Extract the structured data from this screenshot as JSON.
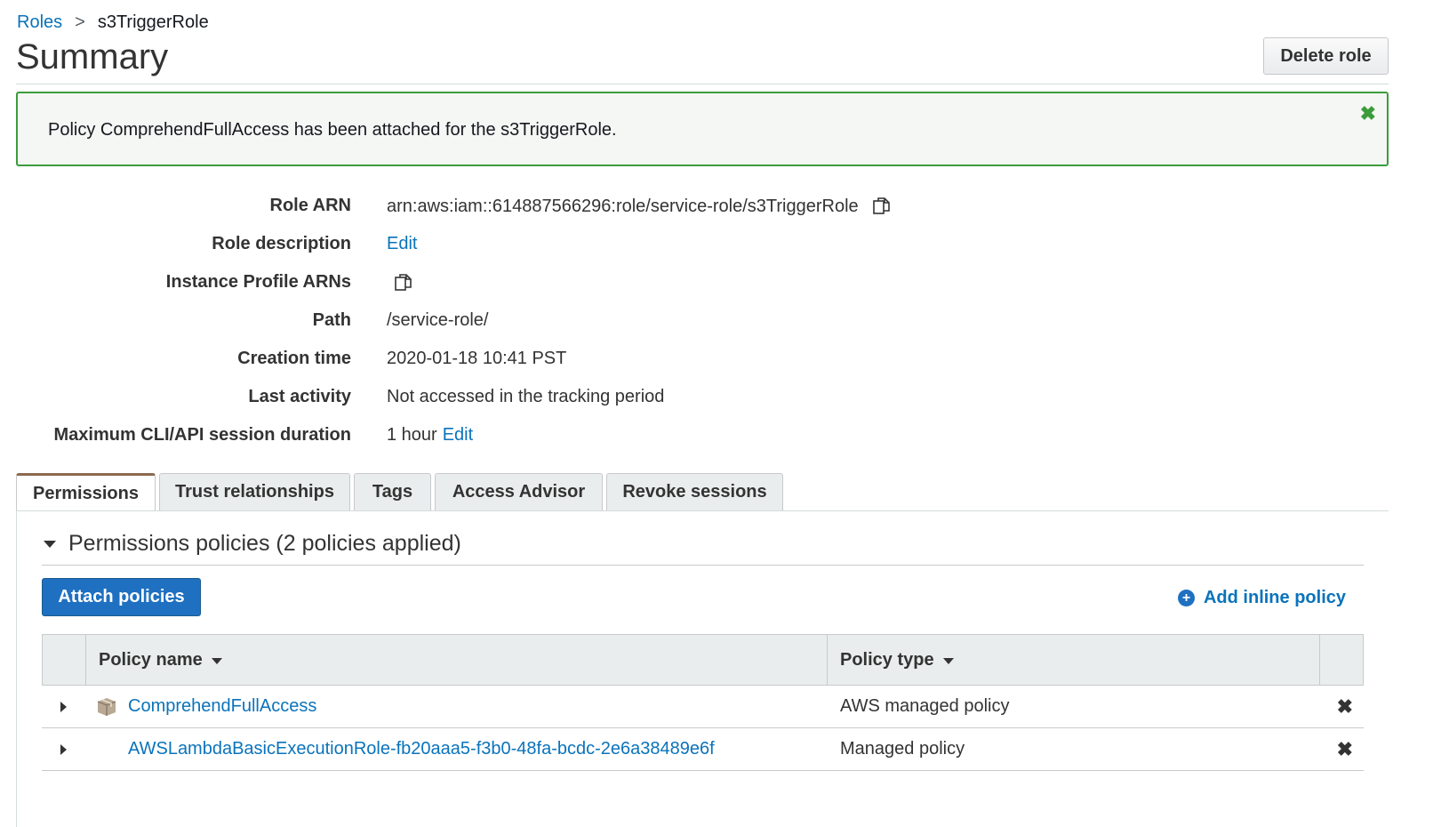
{
  "breadcrumb": {
    "parent": "Roles",
    "separator": ">",
    "current": "s3TriggerRole"
  },
  "page": {
    "title": "Summary",
    "delete_label": "Delete role"
  },
  "alert": {
    "message": "Policy ComprehendFullAccess has been attached for the s3TriggerRole.",
    "close_glyph": "✖",
    "color": "#3c9c3c"
  },
  "details": {
    "role_arn_label": "Role ARN",
    "role_arn_value": "arn:aws:iam::614887566296:role/service-role/s3TriggerRole",
    "role_description_label": "Role description",
    "role_description_link": "Edit",
    "instance_profile_label": "Instance Profile ARNs",
    "path_label": "Path",
    "path_value": "/service-role/",
    "creation_time_label": "Creation time",
    "creation_time_value": "2020-01-18 10:41 PST",
    "last_activity_label": "Last activity",
    "last_activity_value": "Not accessed in the tracking period",
    "max_session_label": "Maximum CLI/API session duration",
    "max_session_value": "1 hour",
    "max_session_link": "Edit"
  },
  "tabs": [
    {
      "label": "Permissions",
      "active": true
    },
    {
      "label": "Trust relationships",
      "active": false
    },
    {
      "label": "Tags",
      "active": false
    },
    {
      "label": "Access Advisor",
      "active": false
    },
    {
      "label": "Revoke sessions",
      "active": false
    }
  ],
  "permissions": {
    "section_title": "Permissions policies (2 policies applied)",
    "attach_label": "Attach policies",
    "add_inline_label": "Add inline policy",
    "columns": {
      "name": "Policy name",
      "type": "Policy type"
    },
    "rows": [
      {
        "name": "ComprehendFullAccess",
        "type": "AWS managed policy",
        "icon": "aws-managed-box-icon"
      },
      {
        "name": "AWSLambdaBasicExecutionRole-fb20aaa5-f3b0-48fa-bcdc-2e6a38489e6f",
        "type": "Managed policy",
        "icon": ""
      }
    ],
    "remove_glyph": "✖"
  },
  "colors": {
    "link": "#0a73bb",
    "primary_button": "#1f70c1",
    "success": "#3c9c3c",
    "active_tab_accent": "#8c6a4f"
  }
}
